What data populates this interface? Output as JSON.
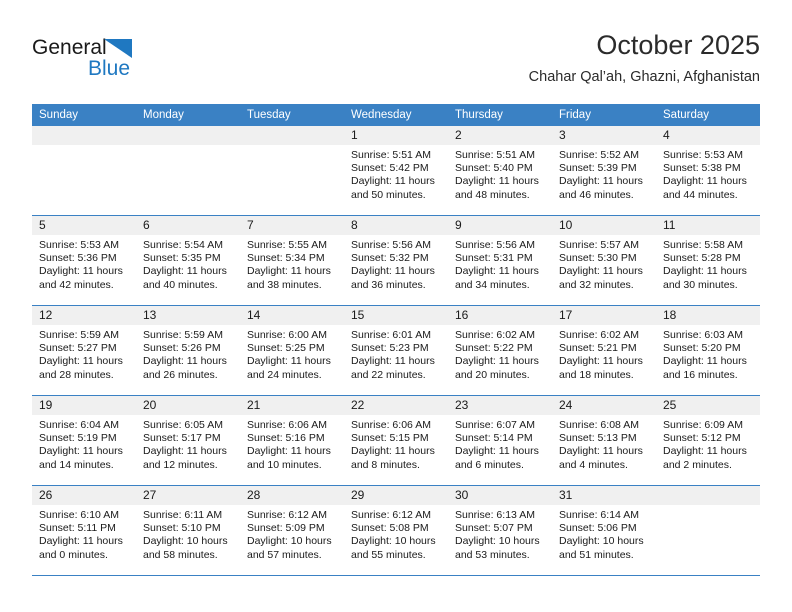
{
  "brand": {
    "line1": "General",
    "line2": "Blue",
    "triangle_color": "#1f78c1",
    "icon": "general-blue-logo"
  },
  "header": {
    "month_title": "October 2025",
    "location": "Chahar Qal’ah, Ghazni, Afghanistan"
  },
  "theme": {
    "header_blue": "#3a81c4",
    "daynum_gray": "#f0f0f0",
    "text": "#1a1a1a"
  },
  "weekday_headers": [
    "Sunday",
    "Monday",
    "Tuesday",
    "Wednesday",
    "Thursday",
    "Friday",
    "Saturday"
  ],
  "labels": {
    "sunrise": "Sunrise:",
    "sunset": "Sunset:",
    "daylight": "Daylight:"
  },
  "weeks": [
    [
      {
        "day": "",
        "blank": true
      },
      {
        "day": "",
        "blank": true
      },
      {
        "day": "",
        "blank": true
      },
      {
        "day": "1",
        "sunrise": "Sunrise: 5:51 AM",
        "sunset": "Sunset: 5:42 PM",
        "daylight_1": "Daylight: 11 hours",
        "daylight_2": "and 50 minutes."
      },
      {
        "day": "2",
        "sunrise": "Sunrise: 5:51 AM",
        "sunset": "Sunset: 5:40 PM",
        "daylight_1": "Daylight: 11 hours",
        "daylight_2": "and 48 minutes."
      },
      {
        "day": "3",
        "sunrise": "Sunrise: 5:52 AM",
        "sunset": "Sunset: 5:39 PM",
        "daylight_1": "Daylight: 11 hours",
        "daylight_2": "and 46 minutes."
      },
      {
        "day": "4",
        "sunrise": "Sunrise: 5:53 AM",
        "sunset": "Sunset: 5:38 PM",
        "daylight_1": "Daylight: 11 hours",
        "daylight_2": "and 44 minutes."
      }
    ],
    [
      {
        "day": "5",
        "sunrise": "Sunrise: 5:53 AM",
        "sunset": "Sunset: 5:36 PM",
        "daylight_1": "Daylight: 11 hours",
        "daylight_2": "and 42 minutes."
      },
      {
        "day": "6",
        "sunrise": "Sunrise: 5:54 AM",
        "sunset": "Sunset: 5:35 PM",
        "daylight_1": "Daylight: 11 hours",
        "daylight_2": "and 40 minutes."
      },
      {
        "day": "7",
        "sunrise": "Sunrise: 5:55 AM",
        "sunset": "Sunset: 5:34 PM",
        "daylight_1": "Daylight: 11 hours",
        "daylight_2": "and 38 minutes."
      },
      {
        "day": "8",
        "sunrise": "Sunrise: 5:56 AM",
        "sunset": "Sunset: 5:32 PM",
        "daylight_1": "Daylight: 11 hours",
        "daylight_2": "and 36 minutes."
      },
      {
        "day": "9",
        "sunrise": "Sunrise: 5:56 AM",
        "sunset": "Sunset: 5:31 PM",
        "daylight_1": "Daylight: 11 hours",
        "daylight_2": "and 34 minutes."
      },
      {
        "day": "10",
        "sunrise": "Sunrise: 5:57 AM",
        "sunset": "Sunset: 5:30 PM",
        "daylight_1": "Daylight: 11 hours",
        "daylight_2": "and 32 minutes."
      },
      {
        "day": "11",
        "sunrise": "Sunrise: 5:58 AM",
        "sunset": "Sunset: 5:28 PM",
        "daylight_1": "Daylight: 11 hours",
        "daylight_2": "and 30 minutes."
      }
    ],
    [
      {
        "day": "12",
        "sunrise": "Sunrise: 5:59 AM",
        "sunset": "Sunset: 5:27 PM",
        "daylight_1": "Daylight: 11 hours",
        "daylight_2": "and 28 minutes."
      },
      {
        "day": "13",
        "sunrise": "Sunrise: 5:59 AM",
        "sunset": "Sunset: 5:26 PM",
        "daylight_1": "Daylight: 11 hours",
        "daylight_2": "and 26 minutes."
      },
      {
        "day": "14",
        "sunrise": "Sunrise: 6:00 AM",
        "sunset": "Sunset: 5:25 PM",
        "daylight_1": "Daylight: 11 hours",
        "daylight_2": "and 24 minutes."
      },
      {
        "day": "15",
        "sunrise": "Sunrise: 6:01 AM",
        "sunset": "Sunset: 5:23 PM",
        "daylight_1": "Daylight: 11 hours",
        "daylight_2": "and 22 minutes."
      },
      {
        "day": "16",
        "sunrise": "Sunrise: 6:02 AM",
        "sunset": "Sunset: 5:22 PM",
        "daylight_1": "Daylight: 11 hours",
        "daylight_2": "and 20 minutes."
      },
      {
        "day": "17",
        "sunrise": "Sunrise: 6:02 AM",
        "sunset": "Sunset: 5:21 PM",
        "daylight_1": "Daylight: 11 hours",
        "daylight_2": "and 18 minutes."
      },
      {
        "day": "18",
        "sunrise": "Sunrise: 6:03 AM",
        "sunset": "Sunset: 5:20 PM",
        "daylight_1": "Daylight: 11 hours",
        "daylight_2": "and 16 minutes."
      }
    ],
    [
      {
        "day": "19",
        "sunrise": "Sunrise: 6:04 AM",
        "sunset": "Sunset: 5:19 PM",
        "daylight_1": "Daylight: 11 hours",
        "daylight_2": "and 14 minutes."
      },
      {
        "day": "20",
        "sunrise": "Sunrise: 6:05 AM",
        "sunset": "Sunset: 5:17 PM",
        "daylight_1": "Daylight: 11 hours",
        "daylight_2": "and 12 minutes."
      },
      {
        "day": "21",
        "sunrise": "Sunrise: 6:06 AM",
        "sunset": "Sunset: 5:16 PM",
        "daylight_1": "Daylight: 11 hours",
        "daylight_2": "and 10 minutes."
      },
      {
        "day": "22",
        "sunrise": "Sunrise: 6:06 AM",
        "sunset": "Sunset: 5:15 PM",
        "daylight_1": "Daylight: 11 hours",
        "daylight_2": "and 8 minutes."
      },
      {
        "day": "23",
        "sunrise": "Sunrise: 6:07 AM",
        "sunset": "Sunset: 5:14 PM",
        "daylight_1": "Daylight: 11 hours",
        "daylight_2": "and 6 minutes."
      },
      {
        "day": "24",
        "sunrise": "Sunrise: 6:08 AM",
        "sunset": "Sunset: 5:13 PM",
        "daylight_1": "Daylight: 11 hours",
        "daylight_2": "and 4 minutes."
      },
      {
        "day": "25",
        "sunrise": "Sunrise: 6:09 AM",
        "sunset": "Sunset: 5:12 PM",
        "daylight_1": "Daylight: 11 hours",
        "daylight_2": "and 2 minutes."
      }
    ],
    [
      {
        "day": "26",
        "sunrise": "Sunrise: 6:10 AM",
        "sunset": "Sunset: 5:11 PM",
        "daylight_1": "Daylight: 11 hours",
        "daylight_2": "and 0 minutes."
      },
      {
        "day": "27",
        "sunrise": "Sunrise: 6:11 AM",
        "sunset": "Sunset: 5:10 PM",
        "daylight_1": "Daylight: 10 hours",
        "daylight_2": "and 58 minutes."
      },
      {
        "day": "28",
        "sunrise": "Sunrise: 6:12 AM",
        "sunset": "Sunset: 5:09 PM",
        "daylight_1": "Daylight: 10 hours",
        "daylight_2": "and 57 minutes."
      },
      {
        "day": "29",
        "sunrise": "Sunrise: 6:12 AM",
        "sunset": "Sunset: 5:08 PM",
        "daylight_1": "Daylight: 10 hours",
        "daylight_2": "and 55 minutes."
      },
      {
        "day": "30",
        "sunrise": "Sunrise: 6:13 AM",
        "sunset": "Sunset: 5:07 PM",
        "daylight_1": "Daylight: 10 hours",
        "daylight_2": "and 53 minutes."
      },
      {
        "day": "31",
        "sunrise": "Sunrise: 6:14 AM",
        "sunset": "Sunset: 5:06 PM",
        "daylight_1": "Daylight: 10 hours",
        "daylight_2": "and 51 minutes."
      },
      {
        "day": "",
        "blank": true
      }
    ]
  ]
}
